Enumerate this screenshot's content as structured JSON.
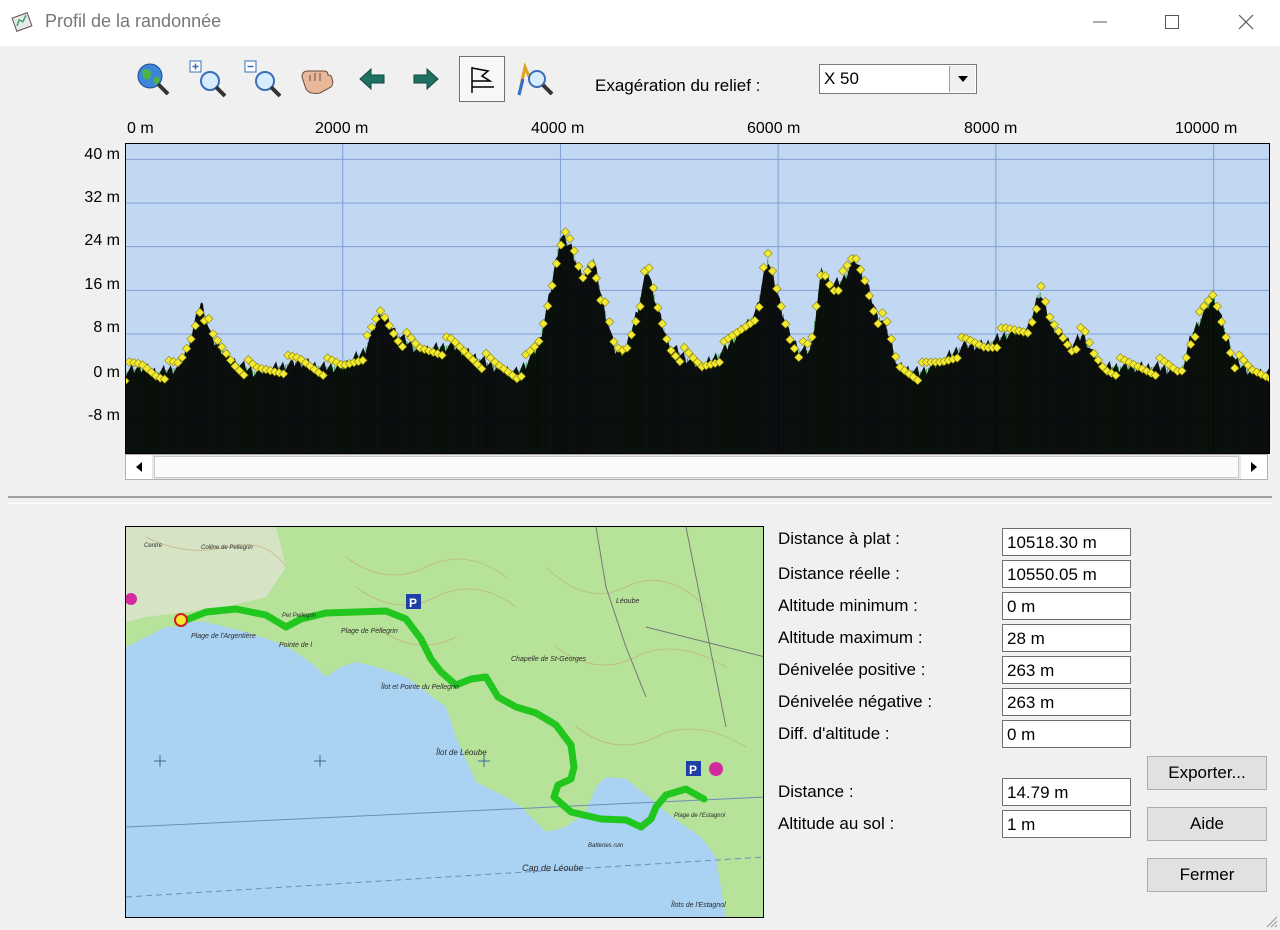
{
  "window": {
    "title": "Profil de la randonnée",
    "controls": [
      "minimize-icon",
      "maximize-icon",
      "close-icon"
    ]
  },
  "toolbar": {
    "tools": [
      "globe-zoom-icon",
      "zoom-in-icon",
      "zoom-out-icon",
      "pan-hand-icon",
      "arrow-left-icon",
      "arrow-right-icon",
      "flag-icon",
      "route-zoom-icon"
    ],
    "active_tool": "flag-icon",
    "exaggeration_label": "Exagération du relief :",
    "exaggeration_value": "X 50"
  },
  "profile": {
    "x_ticks": [
      "0 m",
      "2000 m",
      "4000 m",
      "6000 m",
      "8000 m",
      "10000 m"
    ],
    "y_ticks": [
      "40 m",
      "32 m",
      "24 m",
      "16 m",
      "8 m",
      "0 m",
      "-8 m"
    ],
    "colors": {
      "sky": "#c2d7f2",
      "grid": "#7f9fd6",
      "terrain": "#000000",
      "bars": "#3f9b4f",
      "points": "#f2ea35"
    }
  },
  "chart_data": {
    "type": "area",
    "xlabel": "",
    "ylabel": "",
    "xlim": [
      0,
      10518
    ],
    "ylim": [
      -14,
      43
    ],
    "x_ticks": [
      0,
      2000,
      4000,
      6000,
      8000,
      10000
    ],
    "y_ticks": [
      40,
      32,
      24,
      16,
      8,
      0,
      -8
    ],
    "series": [
      {
        "x": [
          0,
          150,
          300,
          500,
          600,
          700,
          800,
          1000,
          1200,
          1400,
          1600,
          1800,
          2000,
          2200,
          2350,
          2500,
          2700,
          3000,
          3200,
          3400,
          3600,
          3700,
          3800,
          3900,
          4000,
          4100,
          4200,
          4300,
          4400,
          4500,
          4600,
          4700,
          4800,
          4900,
          5000,
          5200,
          5300,
          5500,
          5800,
          5900,
          6000,
          6100,
          6200,
          6300,
          6400,
          6500,
          6600,
          6700,
          6800,
          6900,
          7000,
          7100,
          7300,
          7500,
          7700,
          7900,
          8100,
          8300,
          8400,
          8500,
          8700,
          8800,
          8900,
          9000,
          9200,
          9500,
          9700,
          9800,
          10000,
          10200,
          10350,
          10518
        ],
        "y": [
          1,
          2,
          1,
          2,
          7,
          14,
          7,
          3,
          1,
          2,
          3,
          2,
          2,
          5,
          12,
          8,
          5,
          6,
          4,
          2,
          1,
          3,
          6,
          15,
          26,
          24,
          18,
          22,
          13,
          5,
          5,
          12,
          20,
          12,
          6,
          3,
          2,
          5,
          12,
          22,
          15,
          8,
          5,
          5,
          20,
          17,
          18,
          22,
          18,
          12,
          9,
          2,
          1,
          3,
          6,
          6,
          8,
          9,
          16,
          10,
          6,
          8,
          4,
          2,
          2,
          2,
          1,
          8,
          15,
          3,
          1,
          1
        ]
      }
    ]
  },
  "stats": [
    {
      "label": "Distance à plat :",
      "value": "10518.30 m"
    },
    {
      "label": "Distance réelle :",
      "value": "10550.05 m"
    },
    {
      "label": "Altitude minimum :",
      "value": "0 m"
    },
    {
      "label": "Altitude maximum :",
      "value": "28 m"
    },
    {
      "label": "Dénivelée positive :",
      "value": "263 m"
    },
    {
      "label": "Dénivelée négative :",
      "value": "263 m"
    },
    {
      "label": "Diff. d'altitude :",
      "value": "0 m"
    }
  ],
  "cursor_stats": [
    {
      "label": "Distance :",
      "value": "14.79 m"
    },
    {
      "label": "Altitude au sol :",
      "value": "1 m"
    }
  ],
  "buttons": {
    "export": "Exporter...",
    "help": "Aide",
    "close": "Fermer"
  },
  "map": {
    "labels": [
      "Plage de l'Argentière",
      "Pointe de l",
      "Plage de Pellegrin",
      "Îlot et Pointe du Pellegrin",
      "Îlot de Léoube",
      "Chapelle de St-Georges",
      "Léoube",
      "Plage de l'Estagnol",
      "Batteries ruin",
      "Cap de Léoube",
      "Îlots de l'Estagnol",
      "Pet Pellegrin",
      "Colline de Pellegrin",
      "Centre"
    ],
    "parking_symbol": "P",
    "colors": {
      "sea": "#a9d2f3",
      "forest": "#b7e29a",
      "route": "#21c71f"
    }
  }
}
